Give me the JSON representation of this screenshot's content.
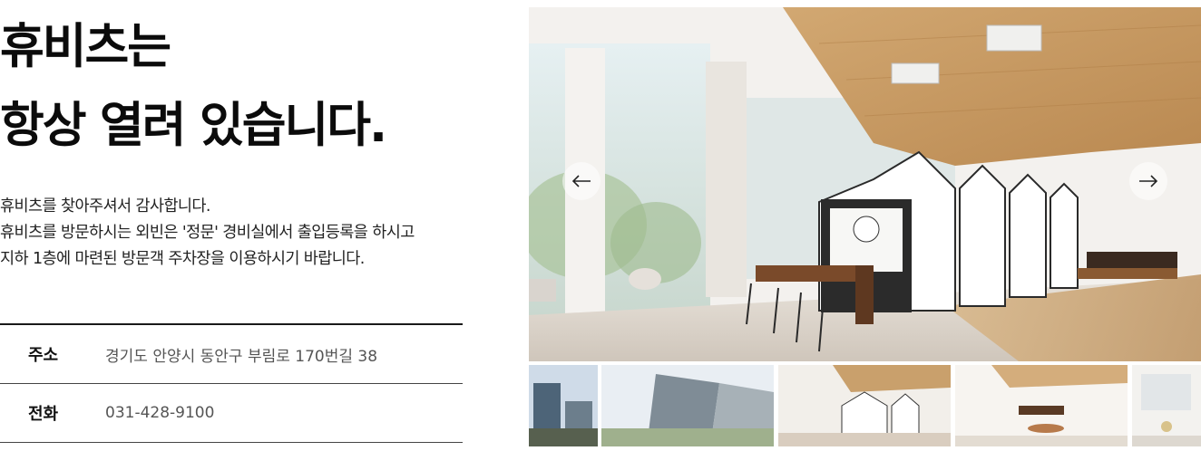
{
  "headline": {
    "line1": "휴비츠는",
    "line2": "항상 열려 있습니다."
  },
  "intro": {
    "line1": "휴비츠를 찾아주셔서 감사합니다.",
    "line2": "휴비츠를 방문하시는 외빈은 '정문' 경비실에서 출입등록을 하시고",
    "line3": "지하 1층에 마련된 방문객 주차장을 이용하시기 바랍니다."
  },
  "info": {
    "address_label": "주소",
    "address_value": "경기도 안양시 동안구 부림로 170번길 38",
    "phone_label": "전화",
    "phone_value": "031-428-9100"
  },
  "gallery": {
    "prev_icon": "arrow-left-icon",
    "next_icon": "arrow-right-icon",
    "thumbnail_count": 5
  },
  "colors": {
    "heading": "#0b0b0b",
    "body_text": "#222222",
    "value_text": "#555555",
    "wood": "#c79a63",
    "divider": "#1a1a1a"
  }
}
